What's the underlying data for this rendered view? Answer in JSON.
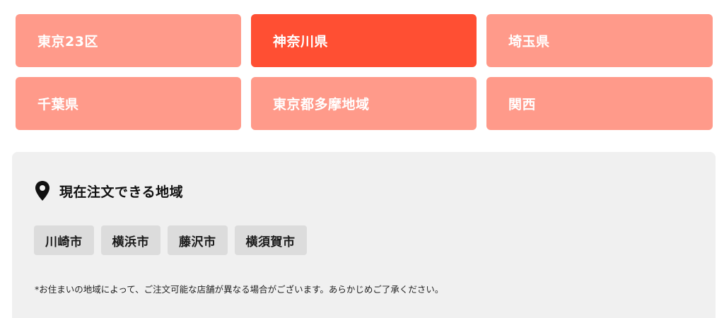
{
  "regions": [
    {
      "label": "東京23区",
      "active": false
    },
    {
      "label": "神奈川県",
      "active": true
    },
    {
      "label": "埼玉県",
      "active": false
    },
    {
      "label": "千葉県",
      "active": false
    },
    {
      "label": "東京都多摩地域",
      "active": false
    },
    {
      "label": "関西",
      "active": false
    }
  ],
  "panel": {
    "icon": "map-pin-icon",
    "title": "現在注文できる地域",
    "cities": [
      "川崎市",
      "横浜市",
      "藤沢市",
      "横須賀市"
    ],
    "note": "*お住まいの地域によって、ご注文可能な店舗が異なる場合がございます。あらかじめご了承ください。"
  },
  "colors": {
    "tile_inactive": "#ff9a8a",
    "tile_active": "#ff4f33",
    "panel_background": "#f0f0f0",
    "chip_background": "#dcdcdc"
  }
}
